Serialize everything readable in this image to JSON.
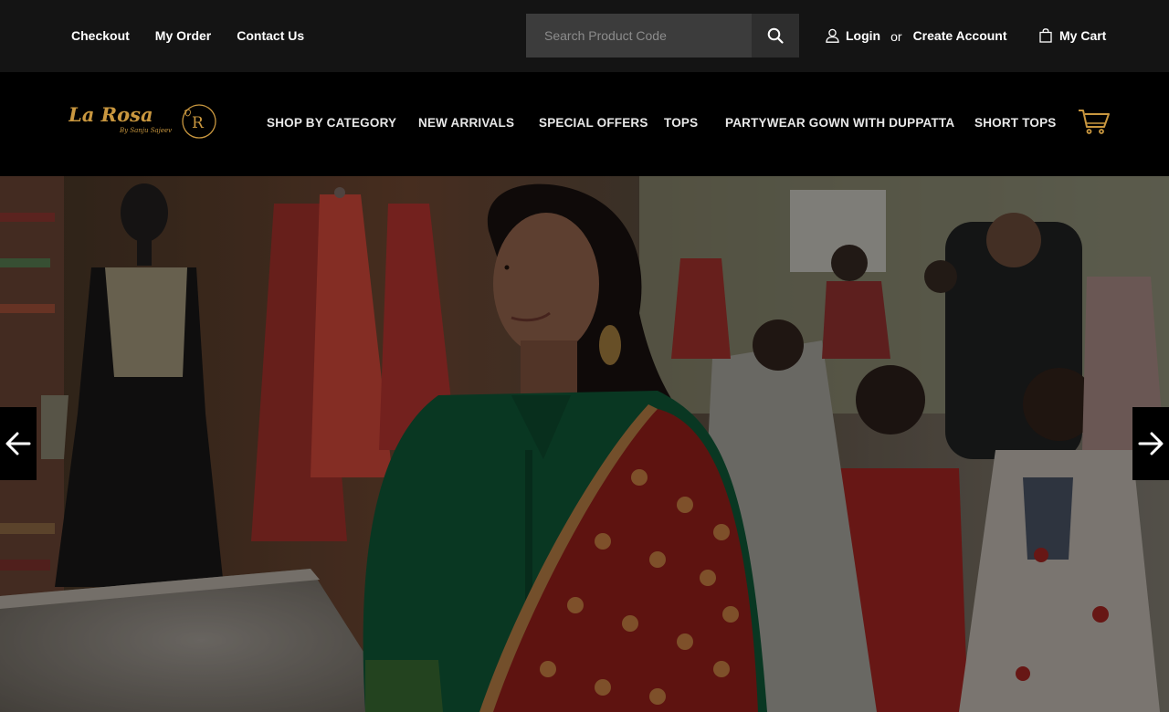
{
  "topbar": {
    "links": [
      "Checkout",
      "My Order",
      "Contact Us"
    ],
    "search_placeholder": "Search Product Code",
    "login": "Login",
    "or": "or",
    "create_account": "Create Account",
    "my_cart": "My Cart"
  },
  "brand": {
    "name": "La Rosa",
    "tagline": "By Sanju Sajeev",
    "monogram": "R",
    "color": "#c9973f"
  },
  "nav": [
    "SHOP BY CATEGORY",
    "NEW ARRIVALS",
    "SPECIAL OFFERS",
    "TOPS",
    "PARTYWEAR GOWN WITH DUPPATTA",
    "SHORT TOPS"
  ],
  "hero": {
    "prev_icon": "arrow-left-icon",
    "next_icon": "arrow-right-icon"
  },
  "icons": {
    "search": "search-icon",
    "user": "user-icon",
    "bag": "shopping-bag-icon",
    "cart": "shopping-cart-icon"
  }
}
